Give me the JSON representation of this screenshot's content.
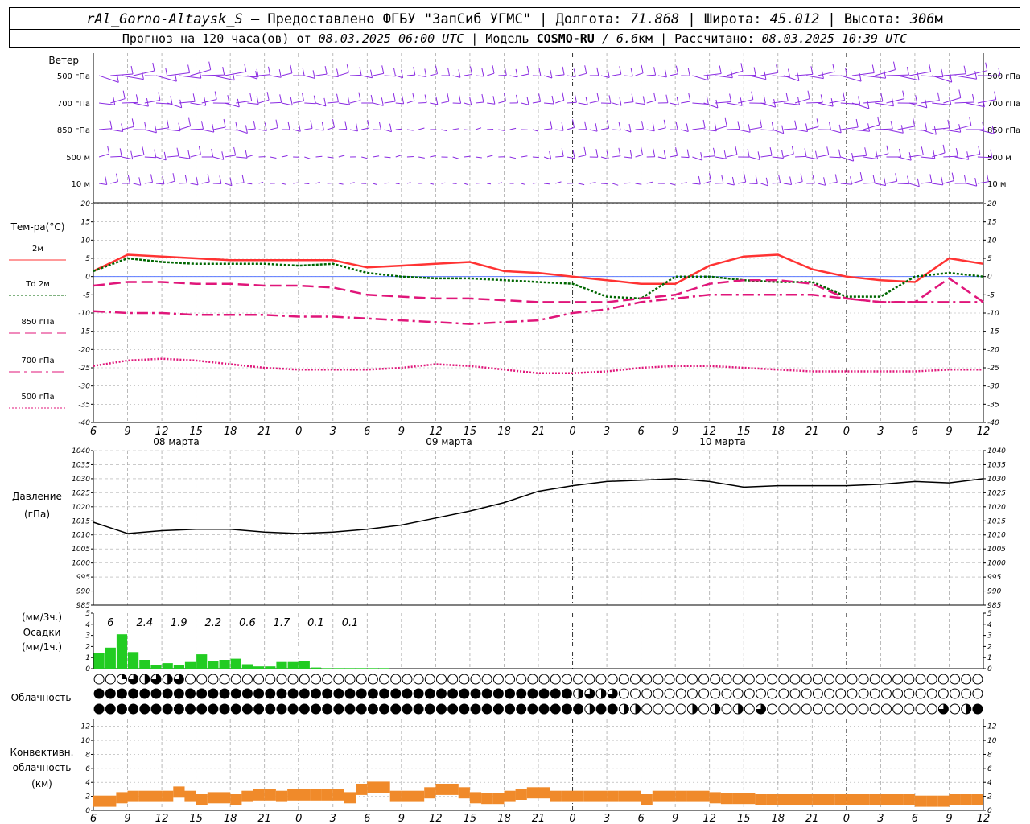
{
  "header": {
    "station": "rAl_Gorno-Altaysk_S",
    "provider": " — Предоставлено ФГБУ \"ЗапСиб УГМС\" | Долгота: ",
    "lon": "71.868",
    "lat_label": " | Широта: ",
    "lat": "45.012",
    "alt_label": " | Высота: ",
    "alt": "306",
    "alt_unit": "м",
    "forecast_prefix": "Прогноз на 120 часа(ов) от ",
    "forecast_from": "08.03.2025 06:00 UTC",
    "model_label": " | Модель ",
    "model": "COSMO-RU",
    "res": " / 6.6",
    "res_unit": "км",
    "calc_label": " | Рассчитано: ",
    "calc": "08.03.2025 10:39 UTC"
  },
  "colors": {
    "t2m": "#ff3333",
    "td": "#006600",
    "t850": "#e0167a",
    "t700": "#e0167a",
    "t500": "#e0167a",
    "pressure": "#000000",
    "precip": "#22cc22",
    "conv": "#f08a2a",
    "wind": "#8a2be2",
    "grid": "#aaaaaa"
  },
  "x_axis": {
    "hour_labels": [
      "6",
      "9",
      "12",
      "15",
      "18",
      "21",
      "0",
      "3",
      "6",
      "9",
      "12",
      "15",
      "18",
      "21",
      "0",
      "3",
      "6",
      "9",
      "12",
      "15",
      "18",
      "21",
      "0",
      "3",
      "6",
      "9",
      "12"
    ],
    "day_labels": [
      "08 марта",
      "09 марта",
      "10 марта"
    ]
  },
  "wind_panel": {
    "title": "Ветер",
    "levels": [
      "500 гПа",
      "700 гПа",
      "850 гПа",
      "500 м",
      "10  м"
    ]
  },
  "temp_panel": {
    "title": "Тем-ра(°С)",
    "legend": [
      "2м",
      "Td  2м",
      "850 гПа",
      "700 гПа",
      "500 гПа"
    ],
    "yticks": [
      "20",
      "15",
      "10",
      "5",
      "0",
      "-5",
      "-10",
      "-15",
      "-20",
      "-25",
      "-30",
      "-35",
      "-40"
    ]
  },
  "pressure_panel": {
    "title": "Давление",
    "unit": "(гПа)",
    "yticks": [
      "1040",
      "1035",
      "1030",
      "1025",
      "1020",
      "1015",
      "1010",
      "1005",
      "1000",
      "995",
      "990",
      "985"
    ]
  },
  "precip_panel": {
    "unit3": "(мм/3ч.)",
    "title": "Осадки",
    "unit1": "(мм/1ч.)",
    "yticks": [
      "5",
      "4",
      "3",
      "2",
      "1",
      "0"
    ],
    "sums": [
      "6",
      "2.4",
      "1.9",
      "2.2",
      "0.6",
      "1.7",
      "0.1",
      "0.1"
    ]
  },
  "cloud_panel": {
    "title": "Облачность"
  },
  "conv_panel": {
    "title1": "Конвективн.",
    "title2": "облачность",
    "unit": "(км)",
    "yticks": [
      "12",
      "10",
      "8",
      "6",
      "4",
      "2",
      "0"
    ]
  },
  "chart_data": [
    {
      "type": "line",
      "title": "Тем-ра(°С)",
      "x_hours": [
        0,
        3,
        6,
        9,
        12,
        15,
        18,
        21,
        24,
        27,
        30,
        33,
        36,
        39,
        42,
        45,
        48,
        51,
        54,
        57,
        60,
        63,
        66,
        69,
        72,
        75,
        78
      ],
      "ylim": [
        -40,
        20
      ],
      "series": [
        {
          "name": "2м",
          "values": [
            1.5,
            6,
            5.5,
            5,
            4.5,
            4.5,
            4.5,
            4.5,
            2.5,
            3,
            3.5,
            4,
            1.5,
            1,
            0,
            -1,
            -2,
            -2,
            3,
            5.5,
            6,
            2,
            0,
            -1,
            -1.5,
            5,
            3.5
          ]
        },
        {
          "name": "Td  2м",
          "values": [
            1.5,
            5,
            4,
            3.5,
            3.5,
            3.5,
            3,
            3.5,
            1,
            0,
            -0.5,
            -0.5,
            -1,
            -1.5,
            -2,
            -5.5,
            -6,
            0,
            0,
            -1,
            -1.5,
            -1.5,
            -5.5,
            -5.5,
            0,
            1,
            0
          ]
        },
        {
          "name": "850 гПа",
          "values": [
            -2.5,
            -1.5,
            -1.5,
            -2,
            -2,
            -2.5,
            -2.5,
            -3,
            -5,
            -5.5,
            -6,
            -6,
            -6.5,
            -7,
            -7,
            -7,
            -6,
            -5,
            -2,
            -1,
            -1,
            -2,
            -6,
            -7,
            -7,
            -0.5,
            -7
          ]
        },
        {
          "name": "700 гПа",
          "values": [
            -9.5,
            -10,
            -10,
            -10.5,
            -10.5,
            -10.5,
            -11,
            -11,
            -11.5,
            -12,
            -12.5,
            -13,
            -12.5,
            -12,
            -10,
            -9,
            -7,
            -6,
            -5,
            -5,
            -5,
            -5,
            -6,
            -7,
            -7,
            -7,
            -7
          ]
        },
        {
          "name": "500 гПа",
          "values": [
            -24.5,
            -23,
            -22.5,
            -23,
            -24,
            -25,
            -25.5,
            -25.5,
            -25.5,
            -25,
            -24,
            -24.5,
            -25.5,
            -26.5,
            -26.5,
            -26,
            -25,
            -24.5,
            -24.5,
            -25,
            -25.5,
            -26,
            -26,
            -26,
            -26,
            -25.5,
            -25.5
          ]
        }
      ]
    },
    {
      "type": "line",
      "title": "Давление",
      "x_hours": [
        0,
        3,
        6,
        9,
        12,
        15,
        18,
        21,
        24,
        27,
        30,
        33,
        36,
        39,
        42,
        45,
        48,
        51,
        54,
        57,
        60,
        63,
        66,
        69,
        72,
        75,
        78
      ],
      "ylim": [
        985,
        1040
      ],
      "series": [
        {
          "name": "Давление",
          "values": [
            1014.5,
            1010.5,
            1011.5,
            1012,
            1012,
            1011,
            1010.5,
            1011,
            1012,
            1013.5,
            1016,
            1018.5,
            1021.5,
            1025.5,
            1027.5,
            1029,
            1029.5,
            1030,
            1029,
            1027,
            1027.5,
            1027.5,
            1027.5,
            1028,
            1029,
            1028.5,
            1030
          ]
        }
      ]
    },
    {
      "type": "bar",
      "title": "Осадки",
      "x_hours": [
        0,
        1,
        2,
        3,
        4,
        5,
        6,
        7,
        8,
        9,
        10,
        11,
        12,
        13,
        14,
        15,
        16,
        17,
        18,
        19,
        20,
        21,
        22,
        23,
        24,
        25,
        26,
        27,
        28,
        29,
        30,
        31,
        32,
        33,
        34,
        35,
        36,
        37,
        38,
        39,
        40,
        41,
        42,
        43,
        44,
        45,
        46,
        47,
        48,
        49,
        50,
        51,
        52,
        53,
        54,
        55,
        56,
        57,
        58,
        59,
        60,
        61,
        62,
        63,
        64,
        65,
        66,
        67,
        68,
        69,
        70,
        71,
        72,
        73,
        74,
        75,
        76,
        77
      ],
      "ylim": [
        0,
        5
      ],
      "values": [
        1.4,
        1.9,
        3.1,
        1.5,
        0.8,
        0.3,
        0.5,
        0.3,
        0.6,
        1.3,
        0.7,
        0.8,
        0.9,
        0.4,
        0.2,
        0.2,
        0.6,
        0.6,
        0.7,
        0.1,
        0.05,
        0.05,
        0.05,
        0.05,
        0.05,
        0.05,
        0,
        0,
        0,
        0,
        0,
        0,
        0,
        0,
        0,
        0,
        0,
        0,
        0,
        0,
        0,
        0,
        0,
        0,
        0,
        0,
        0,
        0,
        0,
        0,
        0,
        0,
        0,
        0,
        0,
        0,
        0,
        0,
        0,
        0,
        0,
        0,
        0,
        0,
        0,
        0,
        0,
        0,
        0,
        0,
        0,
        0,
        0,
        0,
        0,
        0,
        0,
        0
      ]
    },
    {
      "type": "table",
      "title": "Облачность",
      "x_hours": [
        0,
        1,
        2,
        3,
        4,
        5,
        6,
        7,
        8,
        9,
        10,
        11,
        12,
        13,
        14,
        15,
        16,
        17,
        18,
        19,
        20,
        21,
        22,
        23,
        24,
        25,
        26,
        27,
        28,
        29,
        30,
        31,
        32,
        33,
        34,
        35,
        36,
        37,
        38,
        39,
        40,
        41,
        42,
        43,
        44,
        45,
        46,
        47,
        48,
        49,
        50,
        51,
        52,
        53,
        54,
        55,
        56,
        57,
        58,
        59,
        60,
        61,
        62,
        63,
        64,
        65,
        66,
        67,
        68,
        69,
        70,
        71,
        72,
        73,
        74,
        75,
        76,
        77
      ],
      "rows": [
        [
          0,
          0,
          1,
          3,
          2,
          3,
          2,
          3,
          0,
          0,
          0,
          0,
          0,
          0,
          0,
          0,
          0,
          0,
          0,
          0,
          0,
          0,
          0,
          0,
          0,
          0,
          0,
          0,
          0,
          0,
          0,
          0,
          0,
          0,
          0,
          0,
          0,
          0,
          0,
          0,
          0,
          0,
          0,
          0,
          0,
          0,
          0,
          0,
          0,
          0,
          0,
          0,
          0,
          0,
          0,
          0,
          0,
          0,
          0,
          0,
          0,
          0,
          0,
          0,
          0,
          0,
          0,
          0,
          0,
          0,
          0,
          0,
          0,
          0,
          0,
          0,
          0,
          0
        ],
        [
          4,
          4,
          4,
          4,
          4,
          4,
          4,
          4,
          4,
          4,
          4,
          4,
          4,
          4,
          4,
          4,
          4,
          4,
          4,
          4,
          4,
          4,
          4,
          4,
          4,
          4,
          4,
          4,
          4,
          4,
          4,
          4,
          4,
          4,
          4,
          4,
          4,
          4,
          4,
          4,
          4,
          4,
          2,
          3,
          2,
          3,
          0,
          0,
          0,
          0,
          0,
          0,
          0,
          0,
          0,
          0,
          0,
          0,
          0,
          0,
          0,
          0,
          0,
          0,
          0,
          0,
          0,
          0,
          0,
          0,
          0,
          0,
          0,
          0,
          0,
          0,
          0,
          0
        ],
        [
          4,
          4,
          4,
          4,
          4,
          4,
          4,
          4,
          4,
          4,
          4,
          4,
          4,
          4,
          4,
          4,
          4,
          4,
          4,
          4,
          4,
          4,
          4,
          4,
          4,
          4,
          4,
          4,
          4,
          4,
          4,
          4,
          4,
          4,
          4,
          4,
          4,
          4,
          4,
          4,
          4,
          4,
          4,
          2,
          4,
          4,
          2,
          2,
          0,
          0,
          0,
          0,
          2,
          0,
          2,
          0,
          2,
          0,
          3,
          0,
          0,
          0,
          0,
          0,
          0,
          0,
          0,
          0,
          0,
          0,
          0,
          0,
          0,
          0,
          3,
          0,
          2,
          4
        ]
      ]
    },
    {
      "type": "bar",
      "title": "Конвективн. облачность",
      "x_hours": [
        0,
        1,
        2,
        3,
        4,
        5,
        6,
        7,
        8,
        9,
        10,
        11,
        12,
        13,
        14,
        15,
        16,
        17,
        18,
        19,
        20,
        21,
        22,
        23,
        24,
        25,
        26,
        27,
        28,
        29,
        30,
        31,
        32,
        33,
        34,
        35,
        36,
        37,
        38,
        39,
        40,
        41,
        42,
        43,
        44,
        45,
        46,
        47,
        48,
        49,
        50,
        51,
        52,
        53,
        54,
        55,
        56,
        57,
        58,
        59,
        60,
        61,
        62,
        63,
        64,
        65,
        66,
        67,
        68,
        69,
        70,
        71,
        72,
        73,
        74,
        75,
        76,
        77
      ],
      "ylim": [
        0,
        12
      ],
      "values": [
        1.3,
        1.3,
        1.8,
        2,
        2,
        2,
        2,
        2.6,
        2,
        1.5,
        1.8,
        1.8,
        1.5,
        2,
        2.2,
        2.2,
        2,
        2.2,
        2.2,
        2.2,
        2.2,
        2.2,
        1.8,
        3,
        3.3,
        3.3,
        2,
        2,
        2,
        2.5,
        3,
        3,
        2.5,
        1.8,
        1.7,
        1.7,
        2,
        2.3,
        2.5,
        2.5,
        2,
        2,
        2,
        2,
        2,
        2,
        2,
        2,
        1.5,
        2,
        2,
        2,
        2,
        2,
        1.8,
        1.7,
        1.7,
        1.7,
        1.5,
        1.5,
        1.5,
        1.5,
        1.5,
        1.5,
        1.5,
        1.5,
        1.5,
        1.5,
        1.5,
        1.5,
        1.5,
        1.5,
        1.3,
        1.3,
        1.3,
        1.5,
        1.5,
        1.5
      ]
    }
  ]
}
